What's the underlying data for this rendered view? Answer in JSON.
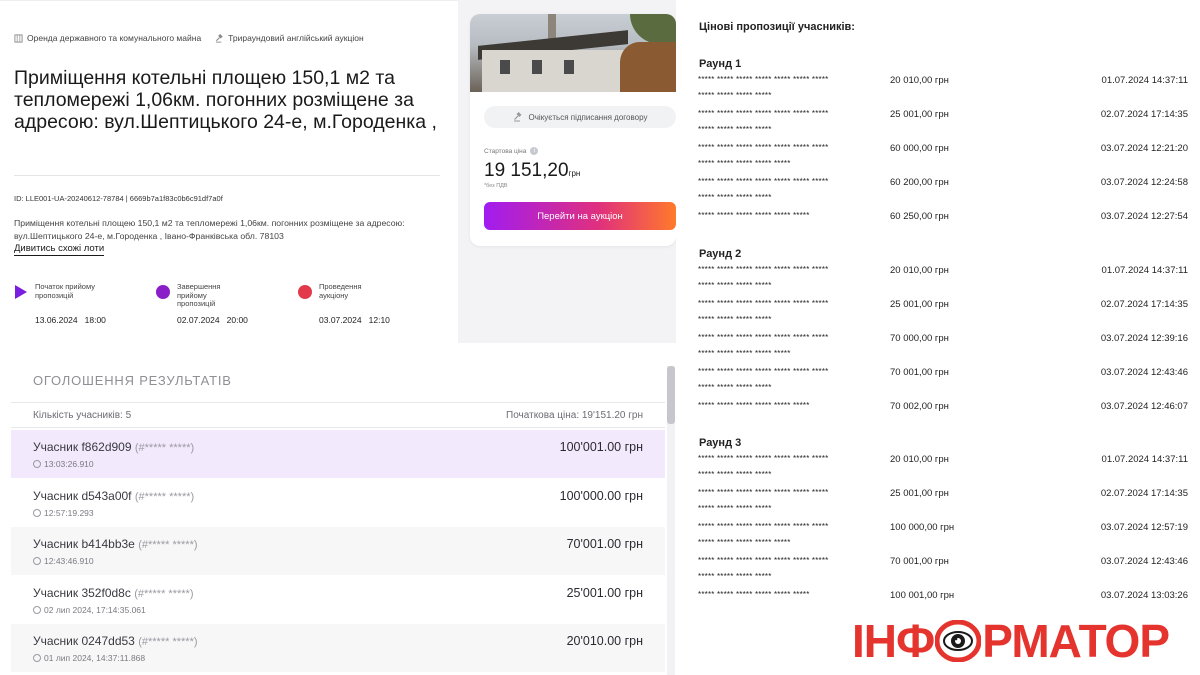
{
  "breadcrumbs": [
    {
      "icon": "building-icon",
      "label": "Оренда державного та комунального майна"
    },
    {
      "icon": "gavel-icon",
      "label": "Трираундовий англійський аукціон"
    }
  ],
  "lot": {
    "title": "Приміщення котельні площею 150,1 м2 та тепломережі 1,06км. погонних розміщене за адресою: вул.Шептицького 24-е, м.Городенка ,",
    "id_line": "ID: LLE001-UA-20240612-78784 | 6669b7a1f83c0b6c91df7a0f",
    "description": "Приміщення котельні площею 150,1 м2 та тепломережі 1,06км. погонних розміщене за адресою: вул.Шептицького 24-е, м.Городенка , Івано-Франківська обл. 78103",
    "similar_link": "Дивитись схожі лоти"
  },
  "timeline": [
    {
      "label": "Початок прийому пропозицій",
      "date": "13.06.2024",
      "time": "18:00",
      "color": "#7a1de0"
    },
    {
      "label": "Завершення прийому пропозицій",
      "date": "02.07.2024",
      "time": "20:00",
      "color": "#8a1ec8"
    },
    {
      "label": "Проведення аукціону",
      "date": "03.07.2024",
      "time": "12:10",
      "color": "#e23a4a"
    }
  ],
  "auction_card": {
    "status": "Очікується підписання договору",
    "start_price_label": "Стартова ціна",
    "start_price": "19 151,20",
    "currency": "грн",
    "vat_note": "*без ПДВ",
    "button_label": "Перейти на аукціон"
  },
  "results": {
    "title": "ОГОЛОШЕННЯ РЕЗУЛЬТАТІВ",
    "participants_label": "Кількість учасників: 5",
    "initial_price_label": "Початкова ціна: 19'151.20 грн",
    "rows": [
      {
        "name": "Учасник f862d909",
        "mask": "(#***** *****)",
        "time": "13:03:26.910",
        "amount": "100'001.00 грн",
        "highlight": true
      },
      {
        "name": "Учасник d543a00f",
        "mask": "(#***** *****)",
        "time": "12:57:19.293",
        "amount": "100'000.00 грн",
        "highlight": false
      },
      {
        "name": "Учасник b414bb3e",
        "mask": "(#***** *****)",
        "time": "12:43:46.910",
        "amount": "70'001.00 грн",
        "highlight": false
      },
      {
        "name": "Учасник 352f0d8c",
        "mask": "(#***** *****)",
        "time": "02 лип 2024, 17:14:35.061",
        "amount": "25'001.00 грн",
        "highlight": false
      },
      {
        "name": "Учасник 0247dd53",
        "mask": "(#***** *****)",
        "time": "01 лип 2024, 14:37:11.868",
        "amount": "20'010.00 грн",
        "highlight": false
      }
    ]
  },
  "bids": {
    "title": "Цінові пропозиції учасників:",
    "rounds": [
      {
        "title": "Раунд 1",
        "offers": [
          {
            "mask1": "***** ***** ***** ***** ***** ***** *****",
            "mask2": "***** ***** ***** *****",
            "amount": "20 010,00 грн",
            "timestamp": "01.07.2024 14:37:11"
          },
          {
            "mask1": "***** ***** ***** ***** ***** ***** *****",
            "mask2": "***** ***** ***** *****",
            "amount": "25 001,00 грн",
            "timestamp": "02.07.2024 17:14:35"
          },
          {
            "mask1": "***** ***** ***** ***** ***** ***** *****",
            "mask2": "***** ***** ***** ***** *****",
            "amount": "60 000,00 грн",
            "timestamp": "03.07.2024 12:21:20"
          },
          {
            "mask1": "***** ***** ***** ***** ***** ***** *****",
            "mask2": "***** ***** ***** *****",
            "amount": "60 200,00 грн",
            "timestamp": "03.07.2024 12:24:58"
          },
          {
            "mask1": "***** ***** ***** ***** ***** *****",
            "mask2": "",
            "amount": "60 250,00 грн",
            "timestamp": "03.07.2024 12:27:54"
          }
        ]
      },
      {
        "title": "Раунд 2",
        "offers": [
          {
            "mask1": "***** ***** ***** ***** ***** ***** *****",
            "mask2": "***** ***** ***** *****",
            "amount": "20 010,00 грн",
            "timestamp": "01.07.2024 14:37:11"
          },
          {
            "mask1": "***** ***** ***** ***** ***** ***** *****",
            "mask2": "***** ***** ***** *****",
            "amount": "25 001,00 грн",
            "timestamp": "02.07.2024 17:14:35"
          },
          {
            "mask1": "***** ***** ***** ***** ***** ***** *****",
            "mask2": "***** ***** ***** ***** *****",
            "amount": "70 000,00 грн",
            "timestamp": "03.07.2024 12:39:16"
          },
          {
            "mask1": "***** ***** ***** ***** ***** ***** *****",
            "mask2": "***** ***** ***** *****",
            "amount": "70 001,00 грн",
            "timestamp": "03.07.2024 12:43:46"
          },
          {
            "mask1": "***** ***** ***** ***** ***** *****",
            "mask2": "",
            "amount": "70 002,00 грн",
            "timestamp": "03.07.2024 12:46:07"
          }
        ]
      },
      {
        "title": "Раунд 3",
        "offers": [
          {
            "mask1": "***** ***** ***** ***** ***** ***** *****",
            "mask2": "***** ***** ***** *****",
            "amount": "20 010,00 грн",
            "timestamp": "01.07.2024 14:37:11"
          },
          {
            "mask1": "***** ***** ***** ***** ***** ***** *****",
            "mask2": "***** ***** ***** *****",
            "amount": "25 001,00 грн",
            "timestamp": "02.07.2024 17:14:35"
          },
          {
            "mask1": "***** ***** ***** ***** ***** ***** *****",
            "mask2": "***** ***** ***** ***** *****",
            "amount": "100 000,00 грн",
            "timestamp": "03.07.2024 12:57:19"
          },
          {
            "mask1": "***** ***** ***** ***** ***** ***** *****",
            "mask2": "***** ***** ***** *****",
            "amount": "70 001,00 грн",
            "timestamp": "03.07.2024 12:43:46"
          },
          {
            "mask1": "***** ***** ***** ***** ***** *****",
            "mask2": "",
            "amount": "100 001,00 грн",
            "timestamp": "03.07.2024 13:03:26"
          }
        ]
      }
    ]
  },
  "logo": {
    "part1": "ІНФ",
    "part2": "РМАТОР",
    "color": "#e4342d"
  },
  "colors": {
    "accent_purple": "#a11cf0",
    "accent_orange": "#ff7a2a",
    "highlight_row": "#f3e9fc",
    "logo_red": "#e4342d"
  }
}
